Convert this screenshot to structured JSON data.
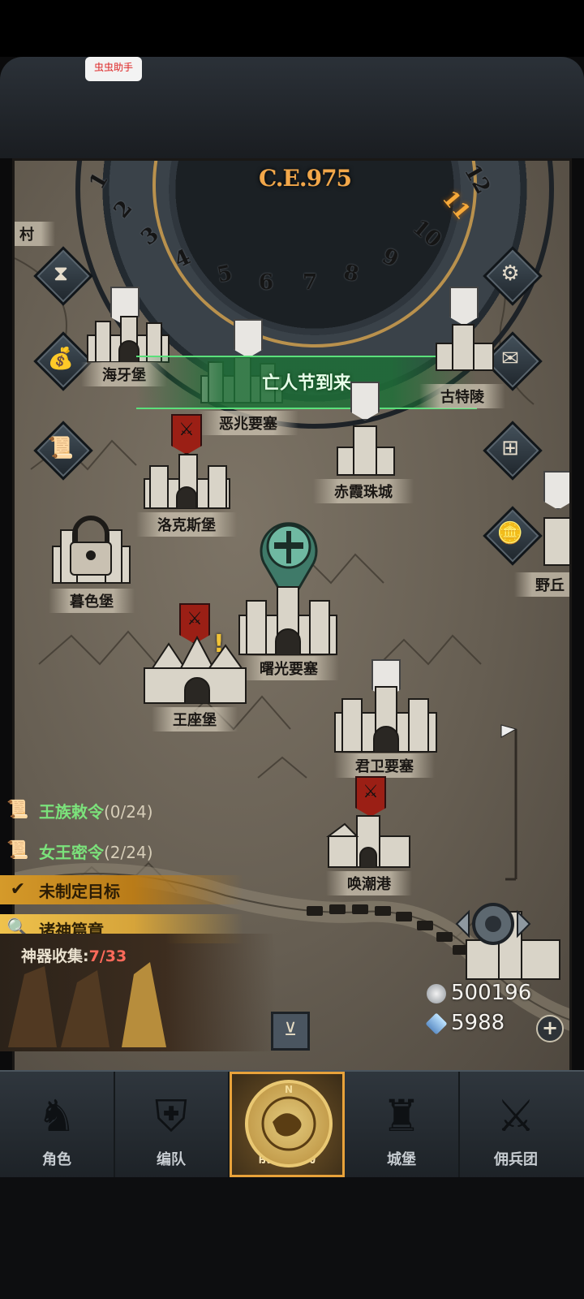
{
  "overlay": {
    "helper_label": "虫虫助手"
  },
  "calendar": {
    "year": "C.E.975",
    "months": [
      "1",
      "2",
      "3",
      "4",
      "5",
      "6",
      "7",
      "8",
      "9",
      "10",
      "11",
      "12"
    ],
    "current_month": "11"
  },
  "event_banner": "亡人节到来",
  "locations": [
    {
      "name": "海牙堡"
    },
    {
      "name": "恶兆要塞"
    },
    {
      "name": "古特陵"
    },
    {
      "name": "赤霞珠城"
    },
    {
      "name": "洛克斯堡"
    },
    {
      "name": "暮色堡"
    },
    {
      "name": "野丘"
    },
    {
      "name": "曙光要塞"
    },
    {
      "name": "王座堡"
    },
    {
      "name": "君卫要塞"
    },
    {
      "name": "唤潮港"
    },
    {
      "name": "村"
    }
  ],
  "side_buttons": {
    "left": [
      "hourglass-icon",
      "money-bag-icon",
      "scroll-map-icon"
    ],
    "right": [
      "gear-icon",
      "mail-icon",
      "window-icon",
      "coin-icon"
    ]
  },
  "quests": [
    {
      "title": "王族敕令",
      "progress": "(0/24)"
    },
    {
      "title": "女王密令",
      "progress": "(2/24)"
    },
    {
      "title": "未制定目标",
      "progress": ""
    },
    {
      "title": "诸神篇章",
      "progress": ""
    }
  ],
  "artifact": {
    "label": "神器收集:",
    "count": "7/33"
  },
  "currency": {
    "silver": "500196",
    "crystal": "5988"
  },
  "nav": {
    "items": [
      {
        "label": "角色"
      },
      {
        "label": "编队"
      },
      {
        "label": "前往群岛"
      },
      {
        "label": "城堡"
      },
      {
        "label": "佣兵团"
      }
    ],
    "compass_letter": "N"
  }
}
